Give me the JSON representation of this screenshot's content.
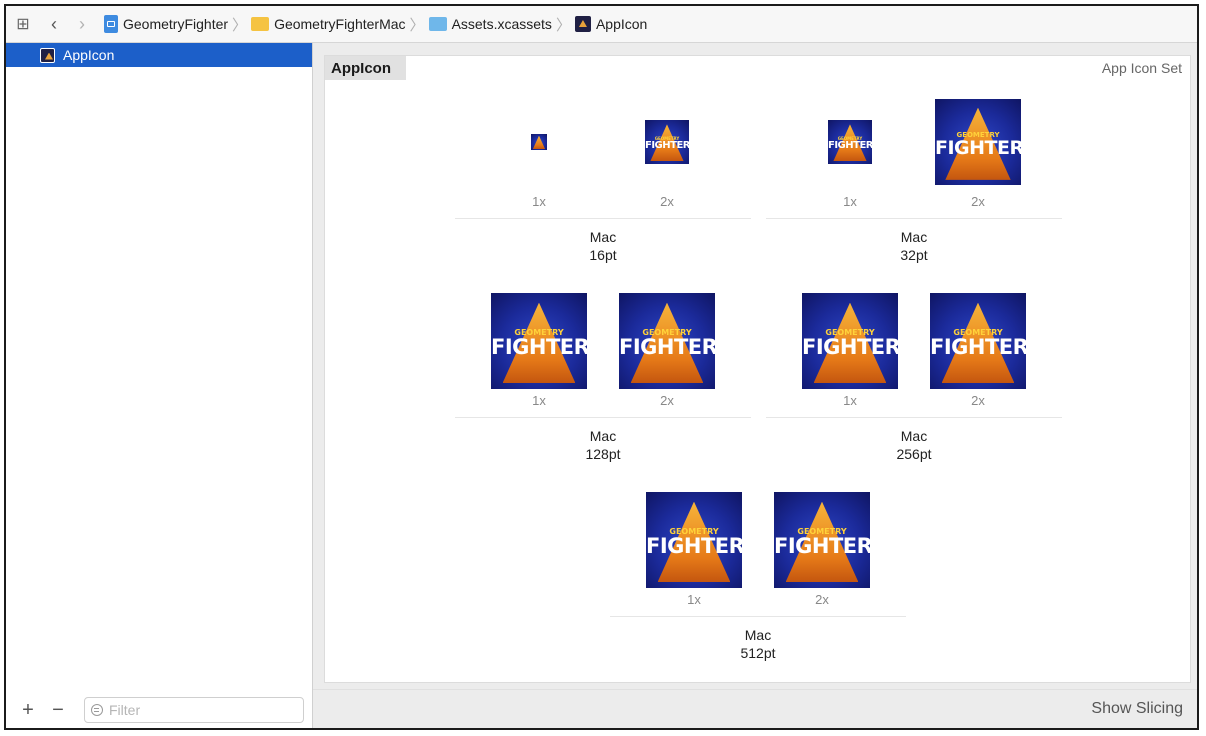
{
  "jumpbar": {
    "crumbs": [
      {
        "label": "GeometryFighter",
        "icon": "project-file-icon"
      },
      {
        "label": "GeometryFighterMac",
        "icon": "folder-icon"
      },
      {
        "label": "Assets.xcassets",
        "icon": "asset-catalog-icon"
      },
      {
        "label": "AppIcon",
        "icon": "app-icon-set-icon"
      }
    ]
  },
  "sidebar": {
    "items": [
      {
        "label": "AppIcon",
        "selected": true
      }
    ],
    "filter_placeholder": "Filter",
    "add_label": "+",
    "remove_label": "−"
  },
  "main": {
    "set_name": "AppIcon",
    "set_kind": "App Icon Set",
    "show_slicing": "Show Slicing",
    "icon_art": {
      "line1": "GEOMETRY",
      "line2": "FIGHTER"
    },
    "groups": [
      {
        "platform": "Mac",
        "size": "16pt",
        "scales": [
          "1x",
          "2x"
        ]
      },
      {
        "platform": "Mac",
        "size": "32pt",
        "scales": [
          "1x",
          "2x"
        ]
      },
      {
        "platform": "Mac",
        "size": "128pt",
        "scales": [
          "1x",
          "2x"
        ]
      },
      {
        "platform": "Mac",
        "size": "256pt",
        "scales": [
          "1x",
          "2x"
        ]
      },
      {
        "platform": "Mac",
        "size": "512pt",
        "scales": [
          "1x",
          "2x"
        ]
      }
    ]
  },
  "colors": {
    "selection": "#1c5fc9",
    "icon_bg": "#1b2a9a",
    "icon_triangle": "#f6b43a"
  }
}
